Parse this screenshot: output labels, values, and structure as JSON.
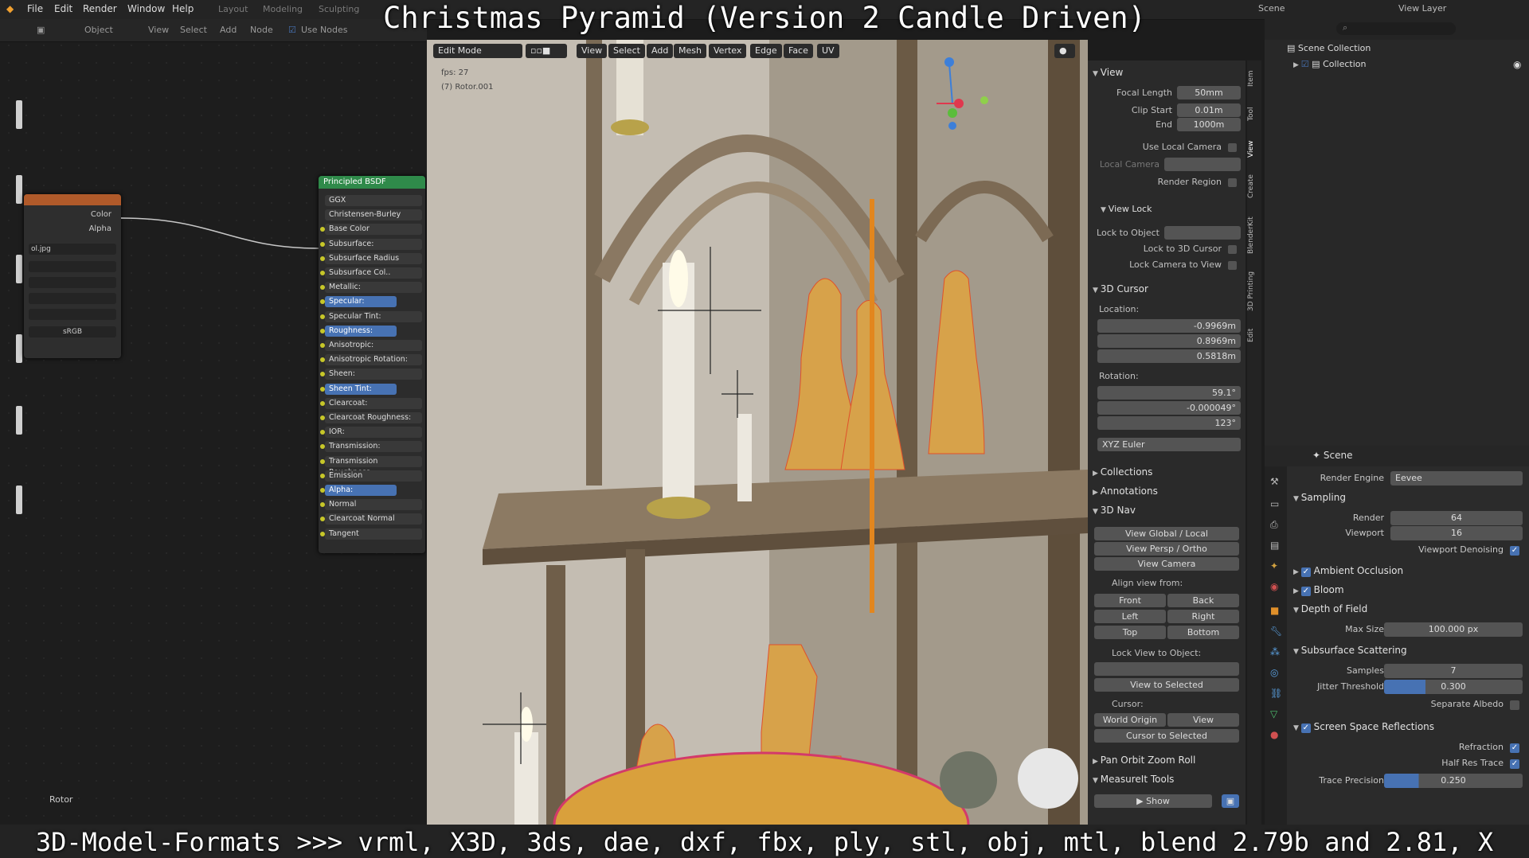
{
  "banner": {
    "title": "Christmas Pyramid (Version 2 Candle Driven)",
    "footer": "3D-Model-Formats >>> vrml, X3D, 3ds, dae, dxf, fbx, ply, stl, obj, mtl, blend 2.79b and 2.81, X"
  },
  "menubar": {
    "items": [
      "File",
      "Edit",
      "Render",
      "Window",
      "Help"
    ],
    "workspaces": [
      "Layout",
      "Modeling",
      "Sculpting"
    ],
    "scene": "Scene",
    "view_layer": "View Layer"
  },
  "node_editor": {
    "header": [
      "Object",
      "View",
      "Select",
      "Add",
      "Node",
      "Use Nodes"
    ],
    "tex_node": {
      "out_color": "Color",
      "out_alpha": "Alpha",
      "image": "ol.jpg",
      "colorspace": "sRGB"
    },
    "bsdf": {
      "title": "Principled BSDF",
      "rows": [
        {
          "label": "GGX",
          "hl": false
        },
        {
          "label": "Christensen-Burley",
          "hl": false
        },
        {
          "label": "Base Color",
          "hl": false
        },
        {
          "label": "Subsurface:",
          "hl": false
        },
        {
          "label": "Subsurface Radius",
          "hl": false
        },
        {
          "label": "Subsurface Col..",
          "hl": false
        },
        {
          "label": "Metallic:",
          "hl": false
        },
        {
          "label": "Specular:",
          "hl": true
        },
        {
          "label": "Specular Tint:",
          "hl": false
        },
        {
          "label": "Roughness:",
          "hl": true
        },
        {
          "label": "Anisotropic:",
          "hl": false
        },
        {
          "label": "Anisotropic Rotation:",
          "hl": false
        },
        {
          "label": "Sheen:",
          "hl": false
        },
        {
          "label": "Sheen Tint:",
          "hl": true
        },
        {
          "label": "Clearcoat:",
          "hl": false
        },
        {
          "label": "Clearcoat Roughness:",
          "hl": false
        },
        {
          "label": "IOR:",
          "hl": false
        },
        {
          "label": "Transmission:",
          "hl": false
        },
        {
          "label": "Transmission Roughness:",
          "hl": false
        },
        {
          "label": "Emission",
          "hl": false
        },
        {
          "label": "Alpha:",
          "hl": true
        },
        {
          "label": "Normal",
          "hl": false
        },
        {
          "label": "Clearcoat Normal",
          "hl": false
        },
        {
          "label": "Tangent",
          "hl": false
        }
      ]
    },
    "bottom_label": "Rotor"
  },
  "viewport": {
    "mode": "Edit Mode",
    "menu": [
      "View",
      "Select",
      "Add",
      "Mesh",
      "Vertex",
      "Edge",
      "Face",
      "UV"
    ],
    "fps": "fps: 27",
    "object": "(7) Rotor.001"
  },
  "npanel": {
    "view_section": "View",
    "focal_length_label": "Focal Length",
    "focal_length": "50mm",
    "clip_start_label": "Clip Start",
    "clip_start": "0.01m",
    "end_label": "End",
    "end": "1000m",
    "use_local_camera": "Use Local Camera",
    "local_camera": "Local Camera",
    "render_region": "Render Region",
    "view_lock": "View Lock",
    "lock_to_object": "Lock to Object",
    "lock_to_cursor": "Lock to 3D Cursor",
    "lock_camera": "Lock Camera to View",
    "cursor_section": "3D Cursor",
    "location": "Location:",
    "loc_x": "-0.9969m",
    "loc_y": "0.8969m",
    "loc_z": "0.5818m",
    "rotation": "Rotation:",
    "rot_x": "59.1°",
    "rot_y": "-0.000049°",
    "rot_z": "123°",
    "rot_mode": "XYZ Euler",
    "collections": "Collections",
    "annotations": "Annotations",
    "nav": "3D Nav",
    "view_global": "View Global / Local",
    "view_persp": "View Persp / Ortho",
    "view_camera": "View Camera",
    "align_from": "Align view from:",
    "front": "Front",
    "back": "Back",
    "left": "Left",
    "right": "Right",
    "top": "Top",
    "bottom": "Bottom",
    "lock_view_obj": "Lock View to Object:",
    "view_selected": "View to Selected",
    "cursor": "Cursor:",
    "world_origin": "World Origin",
    "view": "View",
    "cursor_selected": "Cursor to Selected",
    "pan_orbit": "Pan Orbit Zoom Roll",
    "measureit": "MeasureIt Tools",
    "show": "Show",
    "tabs": [
      "Item",
      "Tool",
      "View",
      "Create",
      "BlenderKit",
      "3D Printing",
      "Edit"
    ]
  },
  "outliner": {
    "scene_collection": "Scene Collection",
    "collection": "Collection"
  },
  "props": {
    "scene": "Scene",
    "render_engine_label": "Render Engine",
    "render_engine": "Eevee",
    "sampling": "Sampling",
    "render_label": "Render",
    "render": "64",
    "viewport_label": "Viewport",
    "viewport": "16",
    "denoise": "Viewport Denoising",
    "ao": "Ambient Occlusion",
    "bloom": "Bloom",
    "dof": "Depth of Field",
    "max_size_label": "Max Size",
    "max_size": "100.000 px",
    "sss": "Subsurface Scattering",
    "samples_label": "Samples",
    "samples": "7",
    "jitter_label": "Jitter Threshold",
    "jitter": "0.300",
    "separate_albedo": "Separate Albedo",
    "ssr": "Screen Space Reflections",
    "refraction": "Refraction",
    "half_res": "Half Res Trace",
    "trace_label": "Trace Precision",
    "trace": "0.250"
  }
}
